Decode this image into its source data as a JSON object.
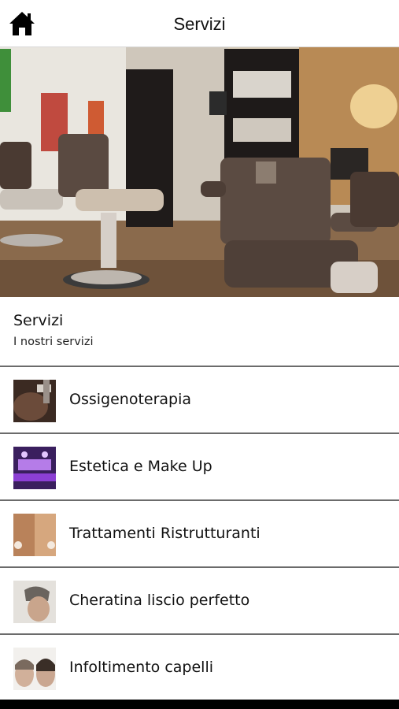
{
  "header": {
    "title": "Servizi",
    "home_icon": "home-icon"
  },
  "hero": {
    "description_icon": "barbershop-photo"
  },
  "intro": {
    "title": "Servizi",
    "subtitle": "I nostri servizi"
  },
  "services": [
    {
      "label": "Ossigenoterapia",
      "thumb": "oxygen-therapy-thumb"
    },
    {
      "label": "Estetica e Make Up",
      "thumb": "makeup-thumb"
    },
    {
      "label": "Trattamenti Ristrutturanti",
      "thumb": "hair-treatment-thumb"
    },
    {
      "label": "Cheratina liscio perfetto",
      "thumb": "keratin-thumb"
    },
    {
      "label": "Infoltimento capelli",
      "thumb": "hair-thickening-thumb"
    }
  ],
  "colors": {
    "divider": "#6b6b6b",
    "text": "#111111"
  }
}
